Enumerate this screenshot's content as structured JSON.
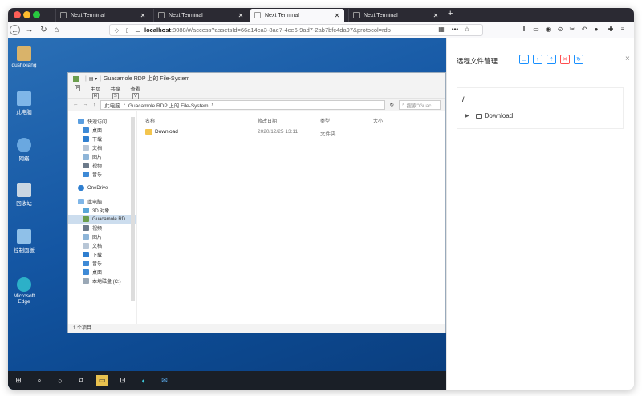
{
  "browser": {
    "tabs": [
      {
        "title": "Next Terminal",
        "active": false
      },
      {
        "title": "Next Terminal",
        "active": false
      },
      {
        "title": "Next Terminal",
        "active": true
      },
      {
        "title": "Next Terminal",
        "active": false
      }
    ],
    "new_tab": "+",
    "url_host": "localhost",
    "url_rest": ":8088/#/access?assetsId=66a14ca3-8ae7-4ce6-9ad7-2ab7bfc4da97&protocol=rdp",
    "menu_dots": "•••",
    "colors": {
      "tabstrip": "#2b2a33",
      "accent": "#1890ff",
      "danger": "#ff4d4f"
    }
  },
  "desktop": {
    "icons": [
      "dushixiang",
      "此电脑",
      "网络",
      "回收站",
      "控制面板",
      "Microsoft Edge"
    ],
    "explorer": {
      "title": "Guacamole RDP 上的 File-System",
      "ribbon": [
        {
          "label": "主页",
          "key": "H"
        },
        {
          "label": "共享",
          "key": "S"
        },
        {
          "label": "查看",
          "key": "V"
        }
      ],
      "ribbon_key_f": "F",
      "ribbon_key_2": "2",
      "address": {
        "crumb_1": "此电脑",
        "crumb_2": "Guacamole RDP 上的 File-System",
        "search": "搜索\"Guac..."
      },
      "nav": {
        "quick_access": "快速访问",
        "quick_items": [
          "桌面",
          "下载",
          "文档",
          "图片",
          "视频",
          "音乐"
        ],
        "onedrive": "OneDrive",
        "this_pc": "此电脑",
        "pc_items": [
          "3D 对象",
          "Guacamole RD",
          "视频",
          "图片",
          "文档",
          "下载",
          "音乐",
          "桌面",
          "本地磁盘 (C:)"
        ]
      },
      "columns": {
        "name": "名称",
        "date": "修改日期",
        "type": "类型",
        "size": "大小"
      },
      "file": {
        "name": "Download",
        "date": "2020/12/25 13:11",
        "type": "文件夹"
      },
      "status": "1 个项目"
    }
  },
  "panel": {
    "title": "远程文件管理",
    "path": "/",
    "tree_item": "Download",
    "close": "×"
  }
}
